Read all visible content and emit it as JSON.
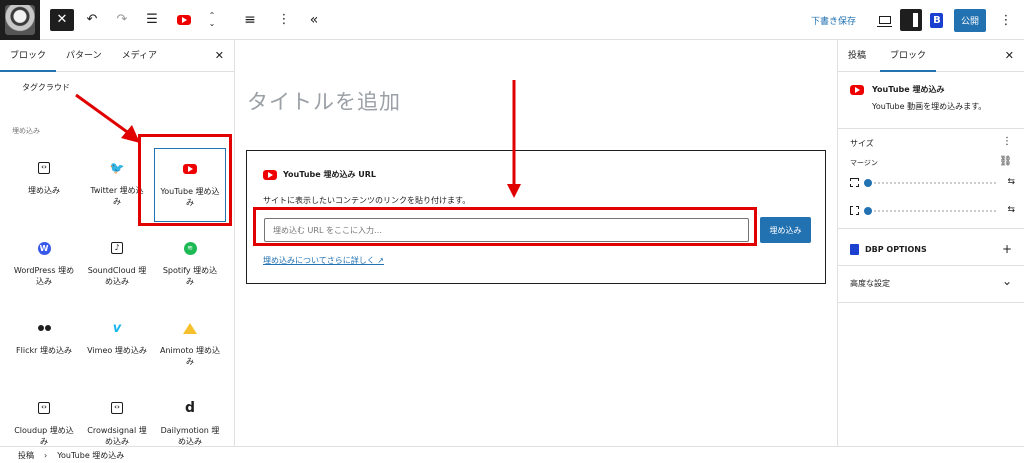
{
  "toolbar": {
    "close": "✕",
    "undo": "↶",
    "redo": "↷",
    "list": "☰",
    "transform": "⌃",
    "align": "≡",
    "more": "⋮",
    "collapse": "«",
    "draft_label": "下書き保存",
    "publish_label": "公開",
    "options": "⋮"
  },
  "inserter": {
    "tabs": [
      "ブロック",
      "パターン",
      "メディア"
    ],
    "close": "✕",
    "tag_cloud": "タグクラウド",
    "category": "埋め込み",
    "blocks": [
      {
        "label": "埋め込み",
        "icon": "embed-icon",
        "glyph": "‹›"
      },
      {
        "label": "Twitter 埋め込み",
        "icon": "twitter-icon",
        "glyph": "🐦"
      },
      {
        "label": "YouTube 埋め込み",
        "icon": "youtube-icon",
        "glyph": ""
      },
      {
        "label": "WordPress 埋め込み",
        "icon": "wordpress-icon",
        "glyph": "W"
      },
      {
        "label": "SoundCloud 埋め込み",
        "icon": "soundcloud-icon",
        "glyph": "♪"
      },
      {
        "label": "Spotify 埋め込み",
        "icon": "spotify-icon",
        "glyph": "≋"
      },
      {
        "label": "Flickr 埋め込み",
        "icon": "flickr-icon",
        "glyph": ""
      },
      {
        "label": "Vimeo 埋め込み",
        "icon": "vimeo-icon",
        "glyph": "v"
      },
      {
        "label": "Animoto 埋め込み",
        "icon": "animoto-icon",
        "glyph": ""
      },
      {
        "label": "Cloudup 埋め込み",
        "icon": "cloudup-icon",
        "glyph": "‹›"
      },
      {
        "label": "Crowdsignal 埋め込み",
        "icon": "crowdsignal-icon",
        "glyph": "‹›"
      },
      {
        "label": "Dailymotion 埋め込み",
        "icon": "dailymotion-icon",
        "glyph": "d"
      }
    ]
  },
  "editor": {
    "title_placeholder": "タイトルを追加",
    "embed": {
      "heading": "YouTube 埋め込み URL",
      "description": "サイトに表示したいコンテンツのリンクを貼り付けます。",
      "input_value": "",
      "input_placeholder": "埋め込む URL をここに入力…",
      "button": "埋め込み",
      "learn_more": "埋め込みについてさらに詳しく ↗"
    }
  },
  "settings": {
    "tabs": [
      "投稿",
      "ブロック"
    ],
    "close": "✕",
    "block_name": "YouTube 埋め込み",
    "block_description": "YouTube 動画を埋め込みます。",
    "size_section": "サイズ",
    "size_more": "⋮",
    "margin_label": "マージン",
    "link_icon": "⛓",
    "tune_icon": "⇆",
    "dbp_section": "DBP OPTIONS",
    "dbp_toggle": "+",
    "advanced_section": "高度な設定",
    "advanced_toggle": "⌄"
  },
  "breadcrumb": {
    "items": [
      "投稿",
      "YouTube 埋め込み"
    ],
    "separator": "›"
  },
  "colors": {
    "accent": "#2271b1",
    "youtube": "#e00000",
    "annotation": "#e00000"
  }
}
